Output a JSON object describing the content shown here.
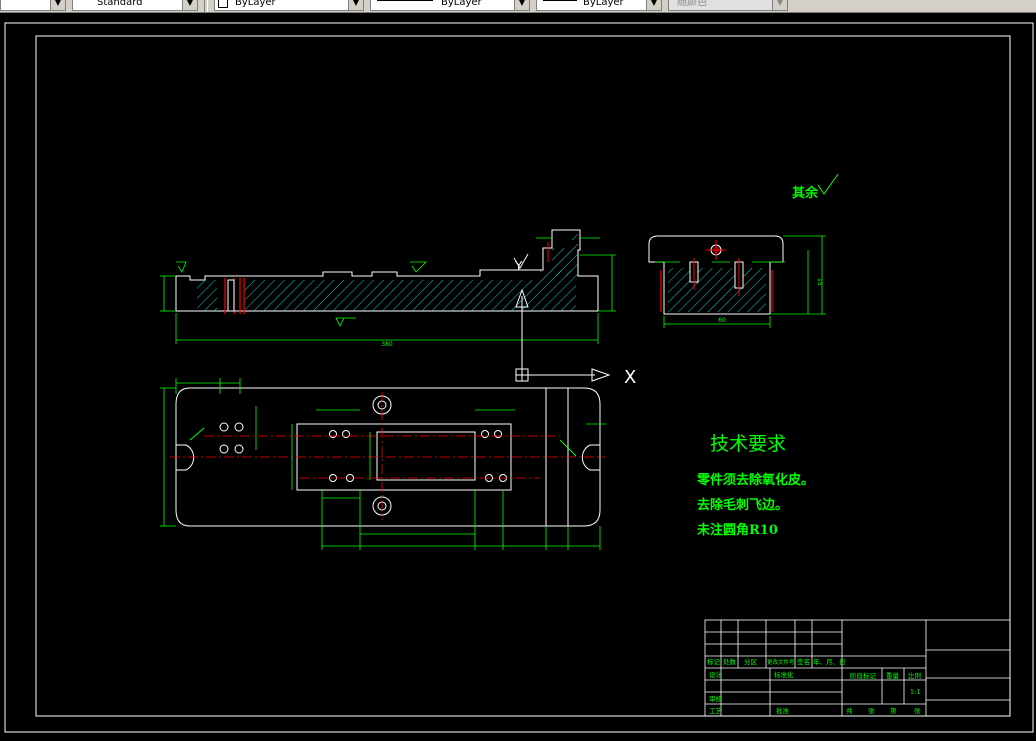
{
  "toolbar": {
    "textstyle_value": "Standard",
    "layer_value": "ByLayer",
    "linetype_value": "ByLayer",
    "lineweight_value": "ByLayer",
    "color_value": "随颜色"
  },
  "drawing": {
    "roughness_note": "其余",
    "front_dim_total": "380",
    "side_dim_width": "60",
    "side_dim_height": "15",
    "tech_title": "技术要求",
    "tech_line1": "零件须去除氧化皮。",
    "tech_line2": "去除毛刺飞边。",
    "tech_line3": "未注圆角R10",
    "axis_x": "X",
    "axis_y": "Y",
    "titleblock": {
      "row_labels": [
        "标记",
        "处数",
        "分区",
        "更改文件号",
        "签名",
        "年、月、日"
      ],
      "design": "设计",
      "standard": "标准化",
      "stage_mark": "阶段标记",
      "weight": "重量",
      "scale": "比例",
      "scale_value": "1:1",
      "review": "审核",
      "process": "工艺",
      "approve": "批准",
      "sheets": "共",
      "sheet_no": "第",
      "sheet_unit": "张",
      "sheet_unit2": "张"
    }
  },
  "colors": {
    "background": "#000000",
    "outline": "#ffffff",
    "dimension": "#00ff00",
    "hatch": "#00ffff",
    "centerline": "#ff0000"
  }
}
